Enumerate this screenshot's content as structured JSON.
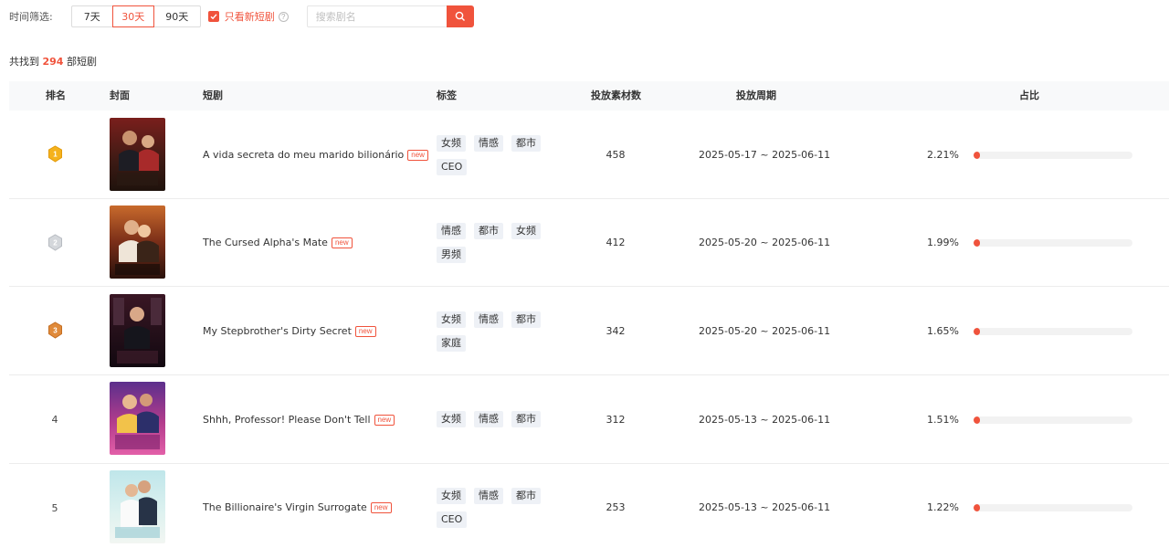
{
  "filter": {
    "label": "时间筛选:",
    "options": [
      "7天",
      "30天",
      "90天"
    ],
    "selected": "30天",
    "only_new_label": "只看新短剧",
    "only_new_checked": true
  },
  "search": {
    "placeholder": "搜索剧名",
    "icon": "search-icon"
  },
  "summary": {
    "prefix": "共找到",
    "count": "294",
    "suffix": "部短剧"
  },
  "table": {
    "headers": {
      "rank": "排名",
      "cover": "封面",
      "title": "短剧",
      "tags": "标签",
      "materials": "投放素材数",
      "period": "投放周期",
      "share": "占比"
    },
    "rows": [
      {
        "rank": "1",
        "rank_style": "gold",
        "title": "A vida secreta do meu marido bilionário",
        "new_badge": "new",
        "tags": [
          "女频",
          "情感",
          "都市",
          "CEO"
        ],
        "materials": "458",
        "period": "2025-05-17 ~ 2025-06-11",
        "share_label": "2.21%",
        "share": 2.21
      },
      {
        "rank": "2",
        "rank_style": "silver",
        "title": "The Cursed Alpha's Mate",
        "new_badge": "new",
        "tags": [
          "情感",
          "都市",
          "女频",
          "男频"
        ],
        "materials": "412",
        "period": "2025-05-20 ~ 2025-06-11",
        "share_label": "1.99%",
        "share": 1.99
      },
      {
        "rank": "3",
        "rank_style": "bronze",
        "title": "My Stepbrother's Dirty Secret",
        "new_badge": "new",
        "tags": [
          "女频",
          "情感",
          "都市",
          "家庭"
        ],
        "materials": "342",
        "period": "2025-05-20 ~ 2025-06-11",
        "share_label": "1.65%",
        "share": 1.65
      },
      {
        "rank": "4",
        "rank_style": "plain",
        "title": "Shhh, Professor! Please Don't Tell",
        "new_badge": "new",
        "tags": [
          "女频",
          "情感",
          "都市"
        ],
        "materials": "312",
        "period": "2025-05-13 ~ 2025-06-11",
        "share_label": "1.51%",
        "share": 1.51
      },
      {
        "rank": "5",
        "rank_style": "plain",
        "title": "The Billionaire's Virgin Surrogate",
        "new_badge": "new",
        "tags": [
          "女频",
          "情感",
          "都市",
          "CEO"
        ],
        "materials": "253",
        "period": "2025-05-13 ~ 2025-06-11",
        "share_label": "1.22%",
        "share": 1.22
      }
    ]
  },
  "colors": {
    "accent": "#f0533c",
    "gold": "#f5b21c",
    "silver": "#c9ccd1",
    "bronze": "#e08a3a",
    "tag_bg": "#eef1f6"
  }
}
